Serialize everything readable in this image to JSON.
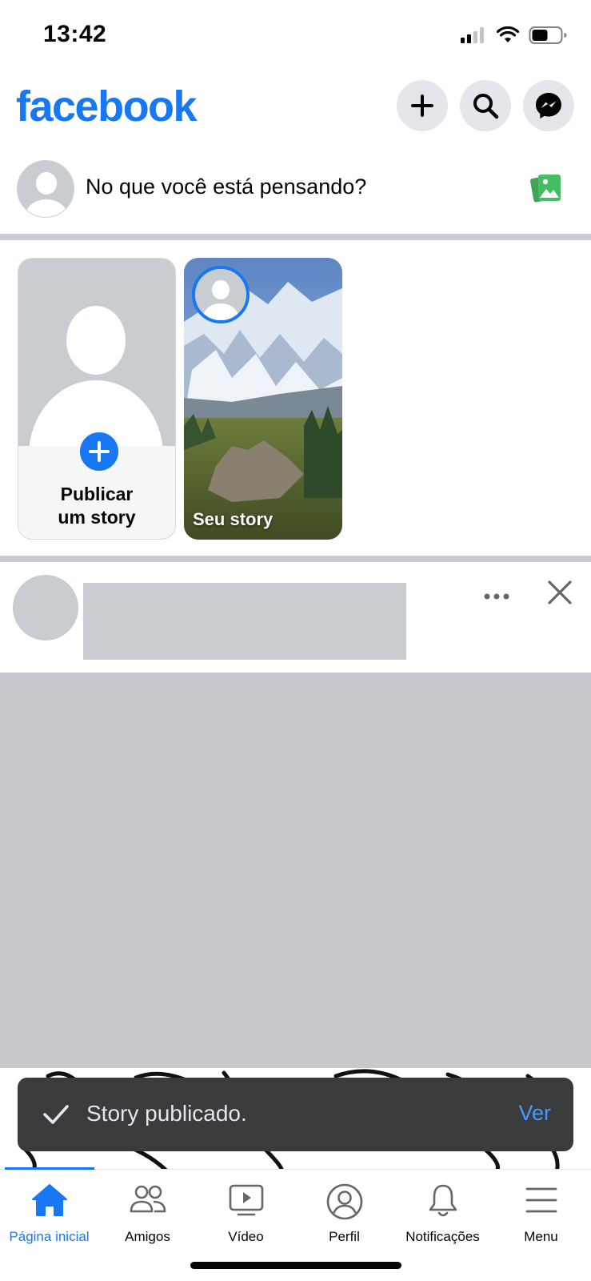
{
  "status_bar": {
    "time": "13:42",
    "icons": [
      "signal-icon",
      "wifi-icon",
      "battery-icon"
    ]
  },
  "header": {
    "logo": "facebook",
    "buttons": [
      "plus-icon",
      "search-icon",
      "messenger-icon"
    ]
  },
  "composer": {
    "placeholder": "No que você está pensando?",
    "photo_icon": "photo-icon"
  },
  "stories": {
    "create_label_line1": "Publicar",
    "create_label_line2": "um story",
    "own_label": "Seu story"
  },
  "toast": {
    "message": "Story publicado.",
    "action": "Ver"
  },
  "tabs": [
    {
      "label": "Página inicial",
      "icon": "home-icon",
      "active": true
    },
    {
      "label": "Amigos",
      "icon": "friends-icon"
    },
    {
      "label": "Vídeo",
      "icon": "video-icon"
    },
    {
      "label": "Perfil",
      "icon": "profile-icon"
    },
    {
      "label": "Notificações",
      "icon": "bell-icon"
    },
    {
      "label": "Menu",
      "icon": "menu-icon"
    }
  ],
  "colors": {
    "brand": "#1877f2",
    "toast_bg": "#3a3b3c",
    "toast_action": "#4599ff",
    "placeholder_gray": "#c9ccd1"
  }
}
